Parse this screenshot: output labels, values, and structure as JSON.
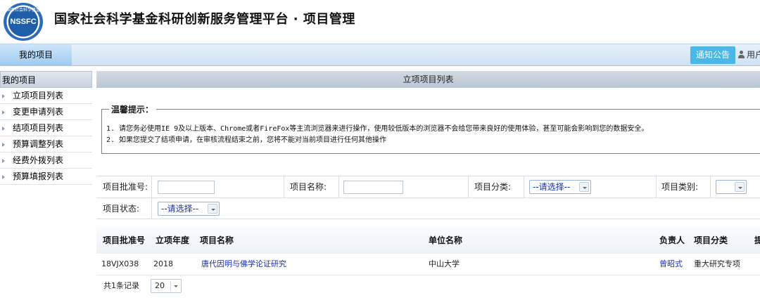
{
  "header": {
    "logo_text": "NSSFC",
    "logo_ring_text": "国家社会科学基金",
    "site_title": "国家社会科学基金科研创新服务管理平台 · 项目管理"
  },
  "nav": {
    "tab_label": "我的项目",
    "notice_label": "通知公告",
    "user_label": "用户"
  },
  "sidebar": {
    "title": "我的项目",
    "items": [
      {
        "label": "立项项目列表"
      },
      {
        "label": "变更申请列表"
      },
      {
        "label": "结项项目列表"
      },
      {
        "label": "预算调整列表"
      },
      {
        "label": "经费外拨列表"
      },
      {
        "label": "预算填报列表"
      }
    ]
  },
  "main": {
    "title": "立项项目列表",
    "tips": {
      "title": "温馨提示：",
      "lines": [
        "1. 请您务必使用IE 9及以上版本、Chrome或者FireFox等主流浏览器来进行操作，使用较低版本的浏览器不会给您带来良好的使用体验，甚至可能会影响到您的数据安全。",
        "2. 如果您提交了结项申请，在审核流程结束之前，您将不能对当前项目进行任何其他操作"
      ]
    },
    "filters": {
      "approval_no_label": "项目批准号:",
      "approval_no_value": "",
      "project_name_label": "项目名称:",
      "project_name_value": "",
      "category_label": "项目分类:",
      "category_value": "--请选择--",
      "type_label": "项目类别:",
      "type_value": "",
      "status_label": "项目状态:",
      "status_value": "--请选择--"
    },
    "table": {
      "columns": [
        "项目批准号",
        "立项年度",
        "项目名称",
        "单位名称",
        "负责人",
        "项目分类",
        "提"
      ],
      "rows": [
        {
          "approval_no": "18VJX038",
          "year": "2018",
          "name": "唐代因明与佛学论证研究",
          "unit": "中山大学",
          "leader": "曾昭式",
          "category": "重大研究专项"
        }
      ]
    },
    "pager": {
      "summary": "共1条记录",
      "page_size": "20"
    }
  }
}
